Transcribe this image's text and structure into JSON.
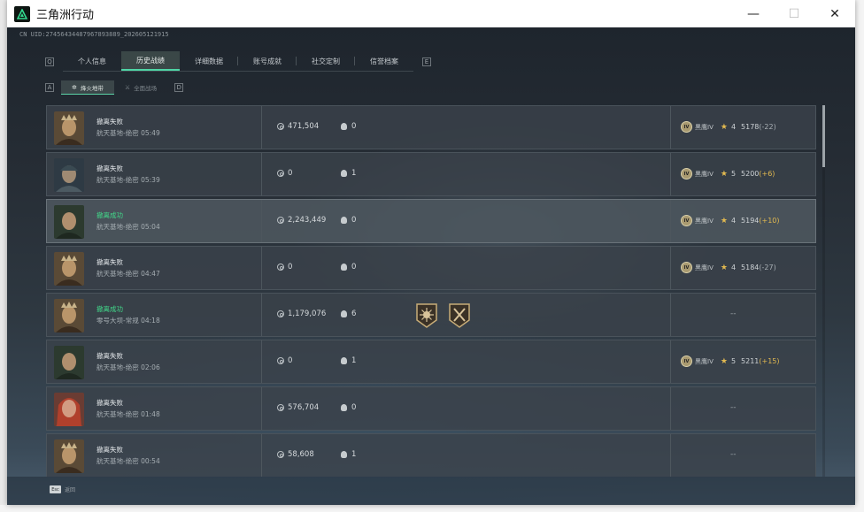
{
  "window": {
    "title": "三角洲行动",
    "controls": {
      "minimize": "—",
      "maximize": "☐",
      "close": "✕"
    }
  },
  "uid": "CN UID:27456434487967893889_202605121915",
  "tabs": [
    {
      "label": "个人信息",
      "active": false
    },
    {
      "label": "历史战绩",
      "active": true
    },
    {
      "label": "详细数据",
      "active": false
    },
    {
      "label": "账号成就",
      "active": false
    },
    {
      "label": "社交定制",
      "active": false
    },
    {
      "label": "信誉档案",
      "active": false
    }
  ],
  "tab_nav": {
    "prev_key": "Q",
    "next_key": "E"
  },
  "subtabs": [
    {
      "label": "烽火地带",
      "active": true
    },
    {
      "label": "全面战场",
      "active": false
    }
  ],
  "subtab_nav": {
    "prev_key": "A",
    "next_key": "D"
  },
  "records": [
    {
      "status": "撤离失败",
      "success": false,
      "map": "航天基地-绝密",
      "time": "05:49",
      "money": "471,504",
      "kills": "0",
      "medals": [],
      "rank": {
        "badge": "IV",
        "name": "黑鹰IV",
        "stars": "4",
        "score": "5178",
        "delta": "(-22)",
        "positive": false
      }
    },
    {
      "status": "撤离失败",
      "success": false,
      "map": "航天基地-绝密",
      "time": "05:39",
      "money": "0",
      "kills": "1",
      "medals": [],
      "rank": {
        "badge": "IV",
        "name": "黑鹰IV",
        "stars": "5",
        "score": "5200",
        "delta": "(+6)",
        "positive": true
      }
    },
    {
      "status": "撤离成功",
      "success": true,
      "map": "航天基地-绝密",
      "time": "05:04",
      "money": "2,243,449",
      "kills": "0",
      "medals": [],
      "rank": {
        "badge": "IV",
        "name": "黑鹰IV",
        "stars": "4",
        "score": "5194",
        "delta": "(+10)",
        "positive": true
      }
    },
    {
      "status": "撤离失败",
      "success": false,
      "map": "航天基地-绝密",
      "time": "04:47",
      "money": "0",
      "kills": "0",
      "medals": [],
      "rank": {
        "badge": "IV",
        "name": "黑鹰IV",
        "stars": "4",
        "score": "5184",
        "delta": "(-27)",
        "positive": false
      }
    },
    {
      "status": "撤离成功",
      "success": true,
      "map": "零号大坝-常规",
      "time": "04:18",
      "money": "1,179,076",
      "kills": "6",
      "medals": [
        "sun-medal-icon",
        "crossed-swords-medal-icon"
      ],
      "rank": null,
      "no_rank": "--"
    },
    {
      "status": "撤离失败",
      "success": false,
      "map": "航天基地-绝密",
      "time": "02:06",
      "money": "0",
      "kills": "1",
      "medals": [],
      "rank": {
        "badge": "IV",
        "name": "黑鹰IV",
        "stars": "5",
        "score": "5211",
        "delta": "(+15)",
        "positive": true
      }
    },
    {
      "status": "撤离失败",
      "success": false,
      "map": "航天基地-绝密",
      "time": "01:48",
      "money": "576,704",
      "kills": "0",
      "medals": [],
      "rank": null,
      "no_rank": "--"
    },
    {
      "status": "撤离失败",
      "success": false,
      "map": "航天基地-绝密",
      "time": "00:54",
      "money": "58,608",
      "kills": "1",
      "medals": [],
      "rank": null,
      "no_rank": "--"
    }
  ],
  "footer": {
    "key": "Esc",
    "label": "返回"
  },
  "colors": {
    "success": "#41d98a",
    "accent": "#4fd6a6",
    "gold": "#e2b950"
  }
}
